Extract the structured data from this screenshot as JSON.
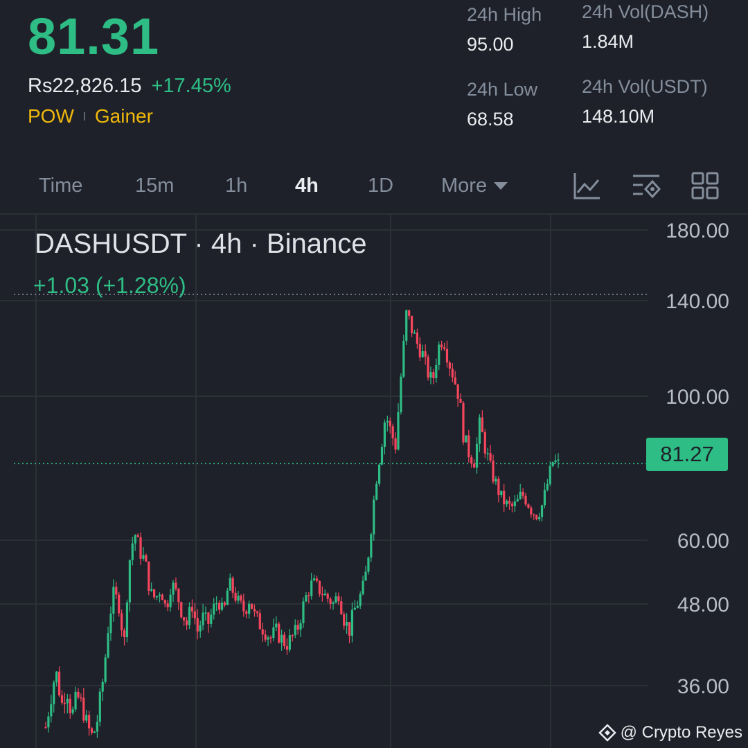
{
  "ticker": {
    "last_price": "81.31",
    "fiat_price": "Rs22,826.15",
    "change_pct": "+17.45%",
    "tags": [
      "POW",
      "Gainer"
    ]
  },
  "stats": {
    "high_label": "24h High",
    "high_value": "95.00",
    "low_label": "24h Low",
    "low_value": "68.58",
    "vol_base_label": "24h Vol(DASH)",
    "vol_base_value": "1.84M",
    "vol_quote_label": "24h Vol(USDT)",
    "vol_quote_value": "148.10M"
  },
  "timeframes": {
    "items": [
      "Time",
      "15m",
      "1h",
      "4h",
      "1D"
    ],
    "active": "4h",
    "more_label": "More"
  },
  "toolbar_icons": [
    "indicator-chart-icon",
    "settings-sliders-icon",
    "grid-layout-icon"
  ],
  "chart_header": {
    "title": "DASHUSDT · 4h · Binance",
    "change": "+1.03 (+1.28%)",
    "current_price_tag": "81.27"
  },
  "watermark": "@ Crypto Reyes",
  "colors": {
    "up": "#2ebd85",
    "down": "#f6465d",
    "background": "#1e2129",
    "grid": "#2b2f36",
    "accent_yellow": "#f0b90b"
  },
  "chart_data": {
    "type": "candlestick",
    "symbol": "DASHUSDT",
    "interval": "4h",
    "exchange": "Binance",
    "y_axis_ticks": [
      180,
      140,
      100,
      60,
      48,
      36
    ],
    "y_axis_labels": [
      "180.00",
      "140.00",
      "100.00",
      "60.00",
      "48.00",
      "36.00"
    ],
    "ylim": [
      30,
      185
    ],
    "scale": "nonlinear",
    "grid": true,
    "current_price": 81.27,
    "high_marker": 143.5,
    "approx_close_path": [
      32,
      35,
      38,
      34,
      36,
      33,
      35,
      34,
      32,
      31,
      33,
      37,
      45,
      50,
      48,
      42,
      56,
      62,
      58,
      56,
      50,
      49,
      51,
      47,
      52,
      50,
      47,
      45,
      48,
      44,
      46,
      45,
      47,
      49,
      46,
      52,
      50,
      48,
      47,
      49,
      46,
      45,
      44,
      43,
      44,
      43,
      42,
      43,
      44,
      47,
      50,
      52,
      51,
      50,
      49,
      48,
      50,
      46,
      44,
      47,
      49,
      52,
      60,
      75,
      85,
      95,
      90,
      86,
      110,
      135,
      128,
      122,
      118,
      110,
      106,
      120,
      125,
      115,
      108,
      100,
      88,
      84,
      82,
      92,
      86,
      80,
      76,
      72,
      70,
      69,
      70,
      73,
      71,
      68,
      67,
      70,
      76,
      82,
      81
    ]
  }
}
